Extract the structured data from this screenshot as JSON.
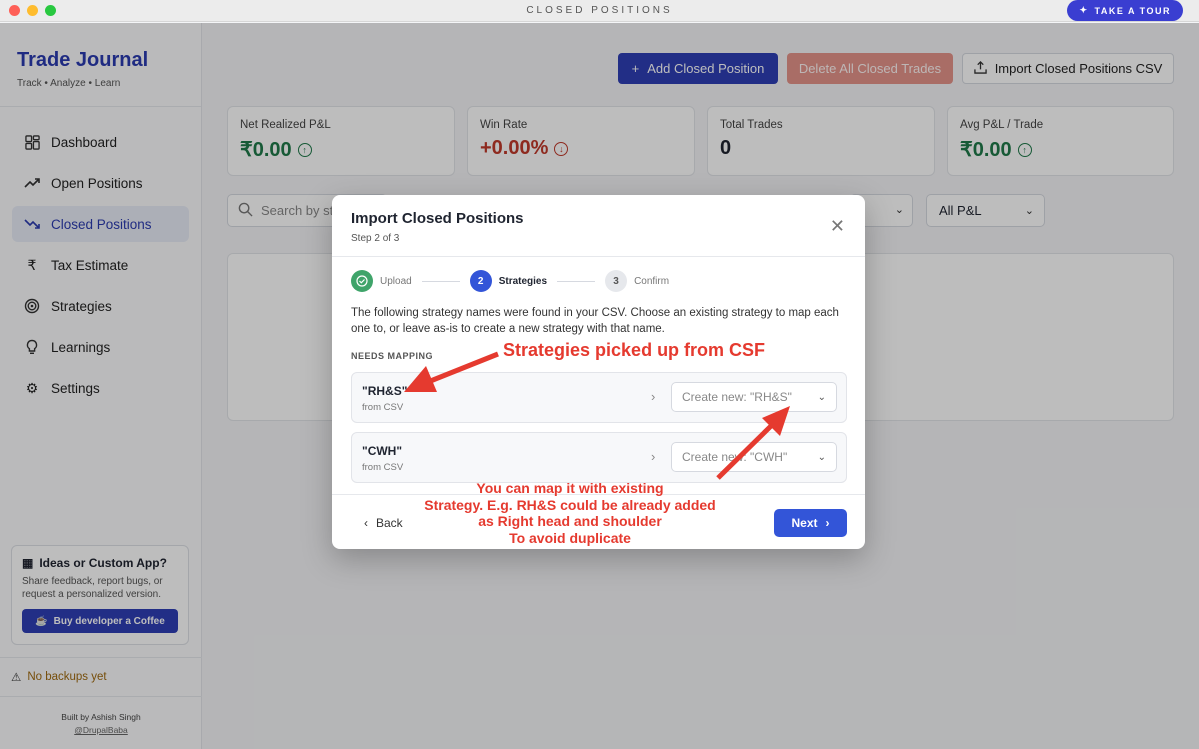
{
  "window": {
    "title": "CLOSED POSITIONS",
    "tour_label": "TAKE A TOUR"
  },
  "brand": {
    "title": "Trade Journal",
    "subtitle": "Track • Analyze • Learn"
  },
  "nav": [
    {
      "label": "Dashboard",
      "icon": "grid-icon"
    },
    {
      "label": "Open Positions",
      "icon": "trend-up-icon"
    },
    {
      "label": "Closed Positions",
      "icon": "trend-down-icon",
      "active": true
    },
    {
      "label": "Tax Estimate",
      "icon": "rupee-icon"
    },
    {
      "label": "Strategies",
      "icon": "target-icon"
    },
    {
      "label": "Learnings",
      "icon": "bulb-icon"
    },
    {
      "label": "Settings",
      "icon": "gear-icon"
    }
  ],
  "ideas": {
    "title": "Ideas or Custom App?",
    "text": "Share feedback, report bugs, or request a personalized version.",
    "button": "Buy developer a Coffee"
  },
  "backup_status": "No backups yet",
  "footer": {
    "built_by": "Built by Ashish Singh",
    "handle": "@DrupalBaba"
  },
  "toolbar": {
    "add": "Add Closed Position",
    "delete": "Delete All Closed Trades",
    "import": "Import Closed Positions CSV"
  },
  "stats": [
    {
      "label": "Net Realized P&L",
      "value": "₹0.00",
      "trend": "up",
      "color": "#1f7a4a"
    },
    {
      "label": "Win Rate",
      "value": "+0.00%",
      "trend": "down",
      "color": "#c0392b"
    },
    {
      "label": "Total Trades",
      "value": "0"
    },
    {
      "label": "Avg P&L / Trade",
      "value": "₹0.00",
      "trend": "up",
      "color": "#1f7a4a"
    }
  ],
  "filters": {
    "search_placeholder": "Search by st",
    "pnl_filter": "All P&L"
  },
  "modal": {
    "title": "Import Closed Positions",
    "step_text": "Step 2 of 3",
    "steps": [
      {
        "num": "",
        "label": "Upload",
        "state": "done"
      },
      {
        "num": "2",
        "label": "Strategies",
        "state": "active"
      },
      {
        "num": "3",
        "label": "Confirm",
        "state": "todo"
      }
    ],
    "description": "The following strategy names were found in your CSV. Choose an existing strategy to map each one to, or leave as-is to create a new strategy with that name.",
    "section_label": "NEEDS MAPPING",
    "rows": [
      {
        "name": "\"RH&S\"",
        "source": "from CSV",
        "select": "Create new: \"RH&S\""
      },
      {
        "name": "\"CWH\"",
        "source": "from CSV",
        "select": "Create new: \"CWH\""
      }
    ],
    "back": "Back",
    "next": "Next"
  },
  "annotations": {
    "top": "Strategies picked up from  CSF",
    "bottom": [
      "You can map it with existing",
      "Strategy. E.g. RH&S could be already added",
      "as Right head and shoulder",
      "To avoid duplicate"
    ]
  },
  "colors": {
    "accent": "#2e3eb5",
    "primary_button": "#3355d8",
    "annotation": "#e53a2f",
    "danger_button": "#e4938a"
  }
}
